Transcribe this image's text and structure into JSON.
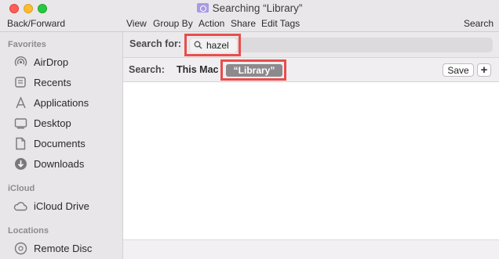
{
  "window": {
    "title": "Searching “Library”",
    "folder_icon": "smart-folder-icon"
  },
  "toolbar": {
    "back_forward": "Back/Forward",
    "view": "View",
    "group_by": "Group By",
    "action": "Action",
    "share": "Share",
    "edit_tags": "Edit Tags",
    "search": "Search"
  },
  "sidebar": {
    "sections": [
      {
        "header": "Favorites",
        "items": [
          {
            "label": "AirDrop",
            "icon": "airdrop-icon"
          },
          {
            "label": "Recents",
            "icon": "recents-icon"
          },
          {
            "label": "Applications",
            "icon": "applications-icon"
          },
          {
            "label": "Desktop",
            "icon": "desktop-icon"
          },
          {
            "label": "Documents",
            "icon": "documents-icon"
          },
          {
            "label": "Downloads",
            "icon": "downloads-icon"
          }
        ]
      },
      {
        "header": "iCloud",
        "items": [
          {
            "label": "iCloud Drive",
            "icon": "icloud-icon"
          }
        ]
      },
      {
        "header": "Locations",
        "items": [
          {
            "label": "Remote Disc",
            "icon": "disc-icon"
          }
        ]
      }
    ]
  },
  "search": {
    "label": "Search for:",
    "token": "hazel"
  },
  "scope": {
    "label": "Search:",
    "this_mac": "This Mac",
    "selected": "“Library”",
    "save_label": "Save",
    "add_label": "+"
  },
  "colors": {
    "highlight": "#e84e4c",
    "scope_selected_bg": "#8c8a8c"
  }
}
